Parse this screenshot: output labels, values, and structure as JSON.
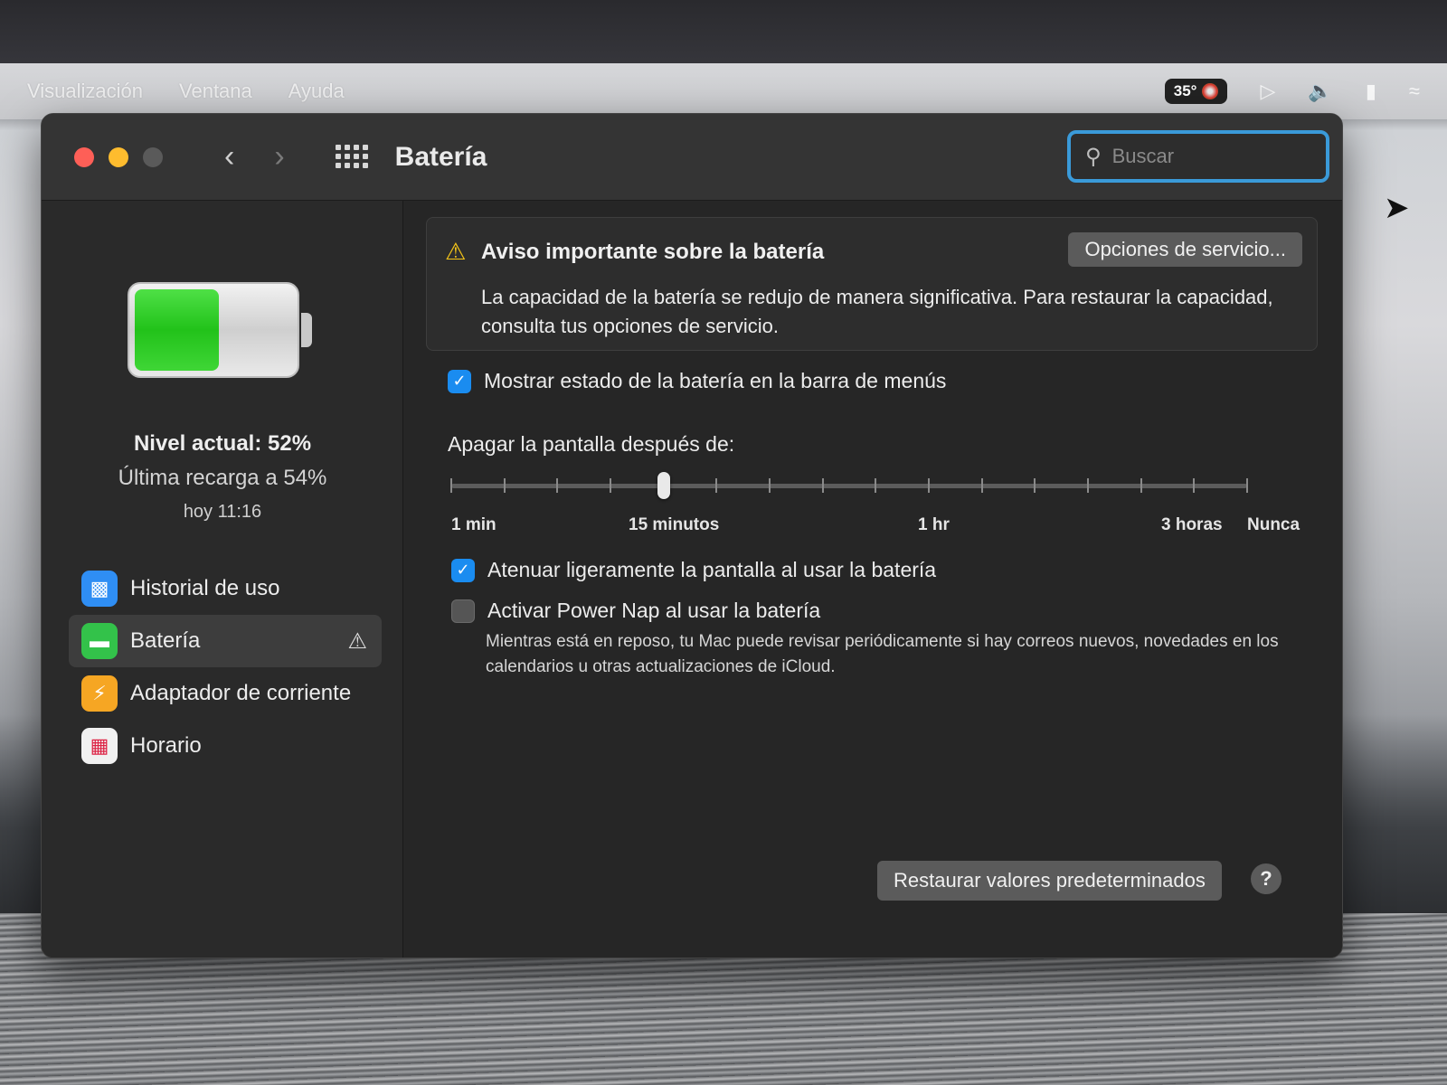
{
  "menubar": {
    "items": [
      "Visualización",
      "Ventana",
      "Ayuda"
    ],
    "temperature": "35°"
  },
  "window": {
    "title": "Batería",
    "search_placeholder": "Buscar"
  },
  "sidebar": {
    "battery_percent": 52,
    "level_text": "Nivel actual: 52%",
    "last_charge_text": "Última recarga a 54%",
    "last_charge_time": "hoy 11:16",
    "items": [
      {
        "label": "Historial de uso",
        "icon": "bar-chart-icon"
      },
      {
        "label": "Batería",
        "icon": "battery-icon",
        "active": true,
        "warning": true
      },
      {
        "label": "Adaptador de corriente",
        "icon": "lightning-icon"
      },
      {
        "label": "Horario",
        "icon": "calendar-icon"
      }
    ]
  },
  "alert": {
    "title": "Aviso importante sobre la batería",
    "service_button": "Opciones de servicio...",
    "body": "La capacidad de la batería se redujo de manera significativa. Para restaurar la capacidad, consulta tus opciones de servicio."
  },
  "options": {
    "show_in_menubar": {
      "label": "Mostrar estado de la batería en la barra de menús",
      "checked": true
    },
    "dim_display": {
      "label": "Atenuar ligeramente la pantalla al usar la batería",
      "checked": true
    },
    "power_nap": {
      "label": "Activar Power Nap al usar la batería",
      "checked": false,
      "description": "Mientras está en reposo, tu Mac puede revisar periódicamente si hay correos nuevos, novedades en los calendarios u otras actualizaciones de iCloud."
    }
  },
  "display_sleep": {
    "label": "Apagar la pantalla después de:",
    "value": "15 minutos",
    "tick_count": 16,
    "selected_tick_index": 4,
    "scale_labels": [
      "1 min",
      "15 minutos",
      "1 hr",
      "3 horas",
      "Nunca"
    ]
  },
  "footer": {
    "restore_button": "Restaurar valores predeterminados",
    "help_button": "?"
  },
  "colors": {
    "accent": "#1a8cf0",
    "battery_fill": "#22c21a",
    "warning": "#f5c518"
  }
}
